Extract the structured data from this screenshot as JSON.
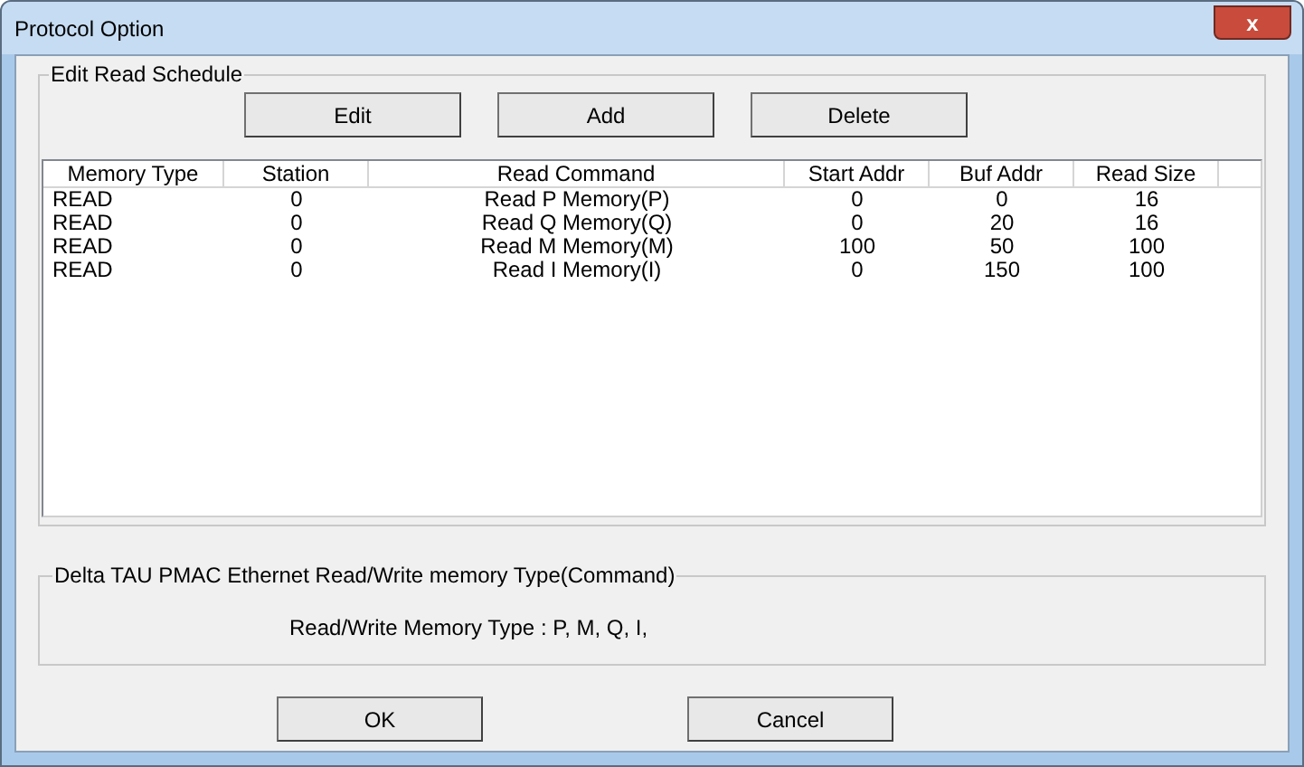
{
  "window": {
    "title": "Protocol Option",
    "close_label": "x"
  },
  "schedule": {
    "legend": "Edit Read Schedule",
    "buttons": [
      "Edit",
      "Add",
      "Delete"
    ],
    "columns": [
      "Memory Type",
      "Station",
      "Read Command",
      "Start Addr",
      "Buf Addr",
      "Read Size"
    ],
    "rows": [
      [
        "READ",
        "0",
        "Read P Memory(P)",
        "0",
        "0",
        "16"
      ],
      [
        "READ",
        "0",
        "Read Q Memory(Q)",
        "0",
        "20",
        "16"
      ],
      [
        "READ",
        "0",
        "Read M Memory(M)",
        "100",
        "50",
        "100"
      ],
      [
        "READ",
        "0",
        "Read I Memory(I)",
        "0",
        "150",
        "100"
      ]
    ]
  },
  "info": {
    "legend": "Delta TAU PMAC Ethernet Read/Write memory Type(Command)",
    "text": "Read/Write Memory Type : P, M, Q, I,"
  },
  "buttons": [
    "OK",
    "Cancel"
  ]
}
